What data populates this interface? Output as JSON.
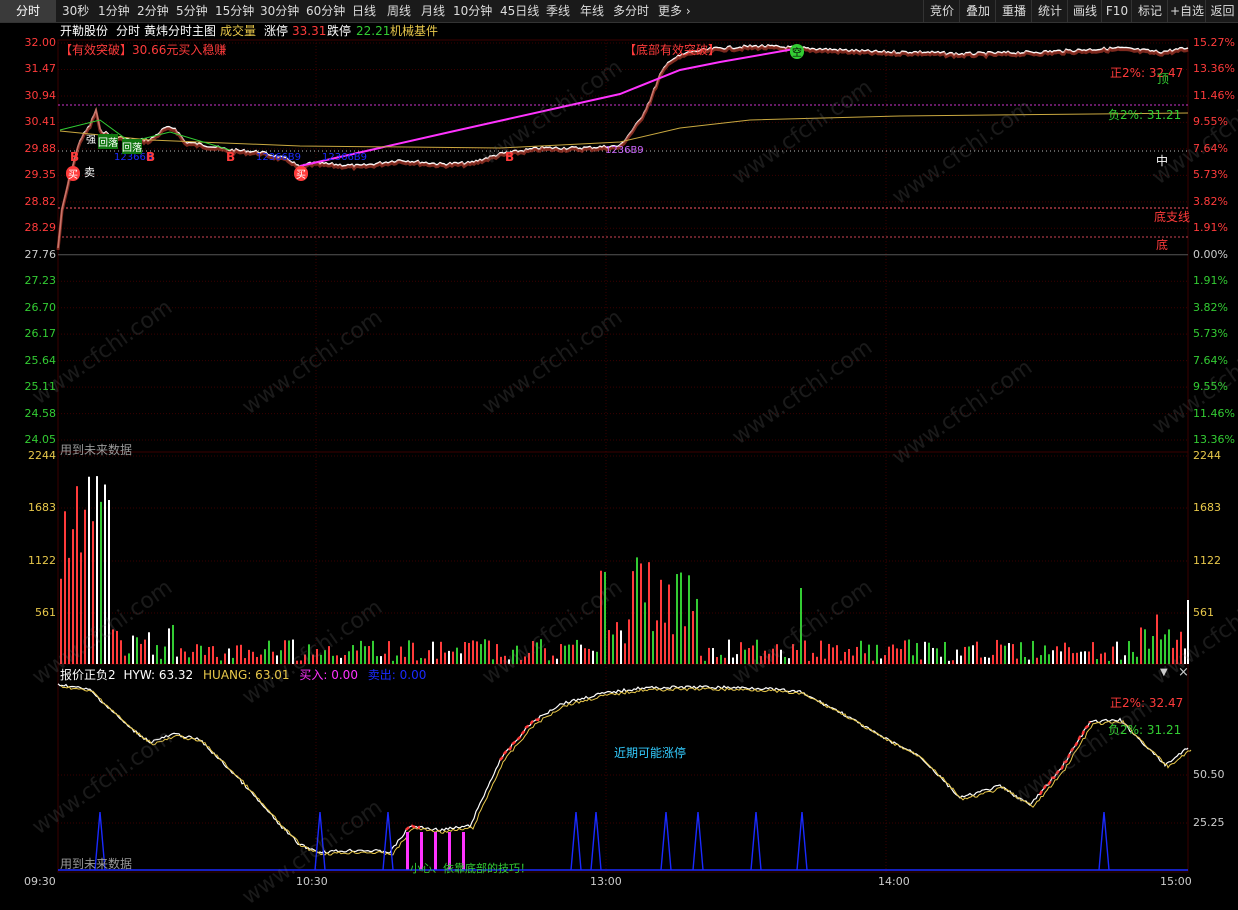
{
  "toolbar": {
    "tabs": [
      "分时",
      "30秒",
      "1分钟",
      "2分钟",
      "5分钟",
      "15分钟",
      "30分钟",
      "60分钟",
      "日线",
      "周线",
      "月线",
      "10分钟",
      "45日线",
      "季线",
      "年线",
      "多分时",
      "更多"
    ],
    "more_chevron": "›",
    "right_buttons": [
      "竞价",
      "叠加",
      "重播",
      "统计",
      "画线",
      "F10",
      "标记",
      "+自选",
      "返回"
    ]
  },
  "info": {
    "stock_name": "开勒股份",
    "mode": "分时",
    "indicator": "黄炜分时主图",
    "volume_label": "成交量",
    "limit_up_label": "涨停",
    "limit_up_value": "33.31",
    "limit_down_label": "跌停",
    "limit_down_value": "22.21",
    "sector": "机械基件"
  },
  "price_axis": {
    "left": [
      "32.00",
      "31.47",
      "30.94",
      "30.41",
      "29.88",
      "29.35",
      "28.82",
      "28.29",
      "27.76",
      "27.23",
      "26.70",
      "26.17",
      "25.64",
      "25.11",
      "24.58",
      "24.05"
    ],
    "right": [
      "15.27%",
      "13.36%",
      "11.46%",
      "9.55%",
      "7.64%",
      "5.73%",
      "3.82%",
      "1.91%",
      "0.00%",
      "1.91%",
      "3.82%",
      "5.73%",
      "7.64%",
      "9.55%",
      "11.46%",
      "13.36%"
    ]
  },
  "volume_axis": {
    "labels": [
      "2244",
      "1683",
      "1122",
      "561"
    ]
  },
  "indicator_axis": {
    "labels": [
      "50.50",
      "25.25"
    ]
  },
  "time_axis": [
    "09:30",
    "10:30",
    "13:00",
    "14:00",
    "15:00"
  ],
  "main_annotations": {
    "breakout": "【有效突破】30.66元买入稳赚",
    "bottom_breakout": "【底部有效突破】",
    "future_data": "用到未来数据",
    "pos2": "正2%: 32.47",
    "neg2": "负2%: 31.21",
    "mid": "中",
    "support": "底支线",
    "bottom": "底",
    "top": "顶",
    "blue_codes": [
      "12366B",
      "12366B9",
      "12366B9",
      "1236B9"
    ],
    "marks": [
      "B",
      "B",
      "B",
      "B",
      "买",
      "卖",
      "买",
      "空",
      "回落",
      "回落",
      "强"
    ]
  },
  "indicator_panel": {
    "title": "报价正负2",
    "hyw_label": "HYW: 63.32",
    "huang_label": "HUANG: 63.01",
    "buy_label": "买入: 0.00",
    "sell_label": "卖出: 0.00",
    "dropdown": "▼",
    "close": "×",
    "pos2": "正2%: 32.47",
    "neg2": "负2%: 31.21",
    "forecast": "近期可能涨停",
    "future_data": "用到未来数据",
    "bottom_note": "小心、依靠底部的技巧！"
  },
  "watermark": "www.cfchi.com",
  "colors": {
    "up": "#ff3b3b",
    "down": "#33cc33",
    "avg_line": "#ff33ff",
    "yellow": "#e8c84a",
    "blue": "#1a2aff",
    "magenta": "#ff33ff",
    "pink_dotted": "#cc33cc",
    "grid": "#3a0000"
  }
}
